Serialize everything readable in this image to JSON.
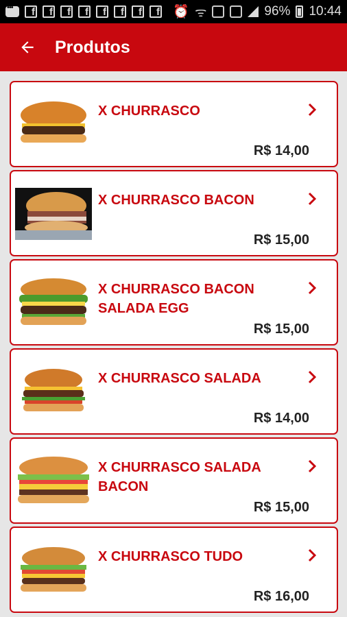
{
  "status_bar": {
    "battery": "96%",
    "time": "10:44"
  },
  "app_bar": {
    "title": "Produtos"
  },
  "colors": {
    "primary": "#c8080f",
    "price": "#222222",
    "background": "#e6e6e6"
  },
  "products": [
    {
      "name": "X CHURRASCO",
      "price": "R$ 14,00"
    },
    {
      "name": "X CHURRASCO BACON",
      "price": "R$ 15,00"
    },
    {
      "name": "X CHURRASCO BACON SALADA EGG",
      "price": "R$ 15,00"
    },
    {
      "name": "X CHURRASCO SALADA",
      "price": "R$ 14,00"
    },
    {
      "name": "X CHURRASCO SALADA BACON",
      "price": "R$ 15,00"
    },
    {
      "name": "X CHURRASCO TUDO",
      "price": "R$ 16,00"
    }
  ]
}
